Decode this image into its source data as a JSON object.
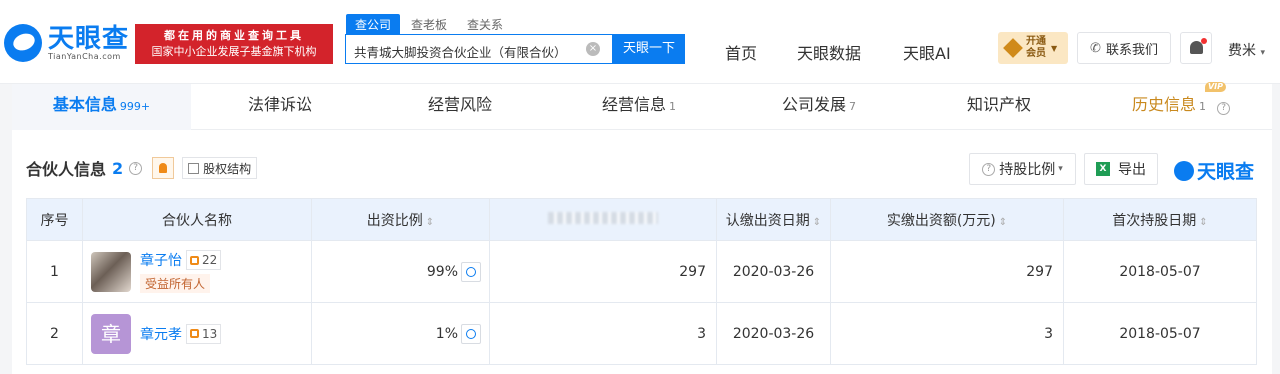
{
  "header": {
    "logo_cn": "天眼查",
    "logo_en": "TianYanCha.com",
    "slogan_line1": "都在用的商业查询工具",
    "slogan_line2": "国家中小企业发展子基金旗下机构",
    "search_tabs": [
      "查公司",
      "查老板",
      "查关系"
    ],
    "search_value": "共青城大脚投资合伙企业（有限合伙）",
    "search_button": "天眼一下",
    "nav": [
      "首页",
      "天眼数据",
      "天眼AI"
    ],
    "vip_label_1": "开通",
    "vip_label_2": "会员",
    "contact_label": "联系我们",
    "user_label": "费米"
  },
  "tabs": [
    {
      "label": "基本信息",
      "count": "999+"
    },
    {
      "label": "法律诉讼",
      "count": ""
    },
    {
      "label": "经营风险",
      "count": ""
    },
    {
      "label": "经营信息",
      "count": "1"
    },
    {
      "label": "公司发展",
      "count": "7"
    },
    {
      "label": "知识产权",
      "count": ""
    },
    {
      "label": "历史信息",
      "count": "1",
      "badge": "VIP"
    }
  ],
  "section": {
    "title": "合伙人信息",
    "count": "2",
    "equity_label": "股权结构",
    "ratio_label": "持股比例",
    "export_label": "导出",
    "brand": "天眼查"
  },
  "table": {
    "headers": [
      "序号",
      "合伙人名称",
      "出资比例",
      "",
      "认缴出资日期",
      "实缴出资额(万元)",
      "首次持股日期"
    ],
    "rows": [
      {
        "index": "1",
        "name": "章子怡",
        "links": "22",
        "tag": "受益所有人",
        "ratio": "99%",
        "amount": "297",
        "sub_date": "2020-03-26",
        "paid": "297",
        "first_date": "2018-05-07"
      },
      {
        "index": "2",
        "name": "章元孝",
        "avatar_char": "章",
        "links": "13",
        "ratio": "1%",
        "amount": "3",
        "sub_date": "2020-03-26",
        "paid": "3",
        "first_date": "2018-05-07"
      }
    ]
  }
}
